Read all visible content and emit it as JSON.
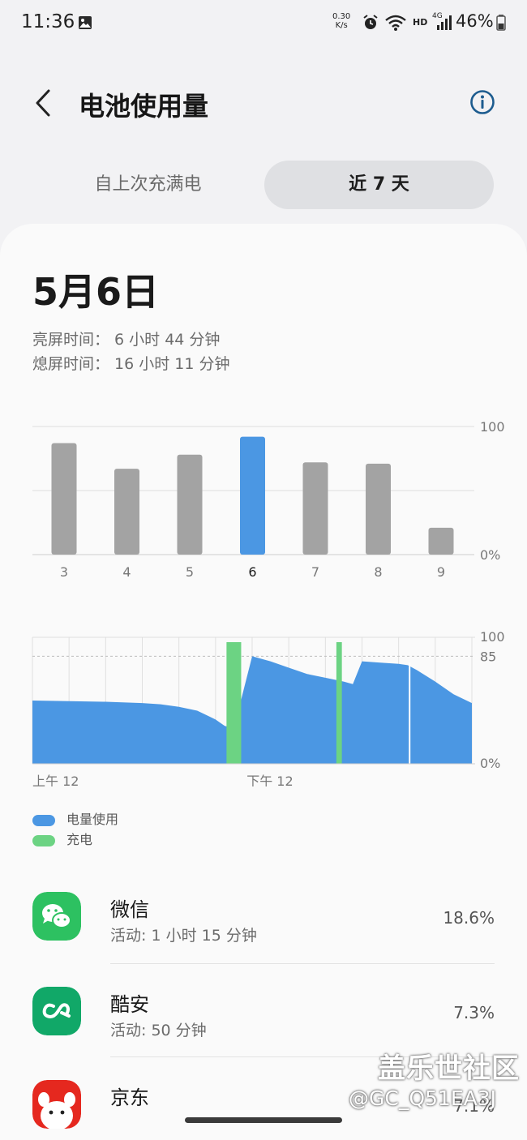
{
  "status_bar": {
    "time": "11:36",
    "net_speed_value": "0.30",
    "net_speed_unit": "K/s",
    "hd": "HD",
    "network": "4G",
    "battery": "46%"
  },
  "header": {
    "title": "电池使用量"
  },
  "tabs": [
    {
      "label": "自上次充满电",
      "selected": false
    },
    {
      "label": "近 7 天",
      "selected": true
    }
  ],
  "summary": {
    "date": "5月6日",
    "screen_on": "亮屏时间： 6 小时 44 分钟",
    "screen_off": "熄屏时间： 16 小时 11 分钟"
  },
  "chart_data": [
    {
      "type": "bar",
      "categories": [
        "3",
        "4",
        "5",
        "6",
        "7",
        "8",
        "9"
      ],
      "values": [
        87,
        67,
        78,
        92,
        72,
        71,
        21
      ],
      "selected_index": 3,
      "ylim": [
        0,
        100
      ],
      "y_tick_labels": [
        "100",
        "0%"
      ],
      "colors": {
        "default": "#a3a3a3",
        "selected": "#4b97e3"
      }
    },
    {
      "type": "area",
      "x_labels": [
        "上午 12",
        "下午 12"
      ],
      "ylim": [
        0,
        100
      ],
      "y_tick_labels": [
        "100",
        "85",
        "0%"
      ],
      "dashed_reference": 85,
      "x_hours": [
        0,
        2,
        4,
        6,
        7,
        8,
        9,
        10,
        10.5,
        11,
        12,
        13,
        14,
        15,
        16,
        17,
        17.5,
        18,
        19,
        20,
        20.5,
        21,
        22,
        23,
        24
      ],
      "y_percent": [
        50,
        49.5,
        49,
        48,
        47,
        45,
        42,
        35,
        30,
        28,
        85,
        81,
        76,
        71,
        68,
        65,
        63,
        81,
        80,
        79,
        78,
        74,
        65,
        55,
        48
      ],
      "charging_intervals": [
        [
          10.6,
          11.4
        ],
        [
          16.6,
          16.9
        ]
      ],
      "colors": {
        "usage": "#4b97e3",
        "charging": "#6cd383"
      }
    }
  ],
  "legend": [
    {
      "label": "电量使用",
      "color": "#4b97e3"
    },
    {
      "label": "充电",
      "color": "#6cd383"
    }
  ],
  "apps": [
    {
      "name": "微信",
      "active": "活动: 1 小时 15 分钟",
      "percent": "18.6%",
      "icon": "wechat-icon",
      "color": "#2dc161"
    },
    {
      "name": "酷安",
      "active": "活动: 50 分钟",
      "percent": "7.3%",
      "icon": "coolapk-icon",
      "color": "#11a868"
    },
    {
      "name": "京东",
      "active": "",
      "percent": "7.1%",
      "icon": "jd-icon",
      "color": "#e5281f"
    }
  ],
  "watermark": {
    "line1": "盖乐世社区",
    "line2": "@GC_Q51EA3J"
  }
}
